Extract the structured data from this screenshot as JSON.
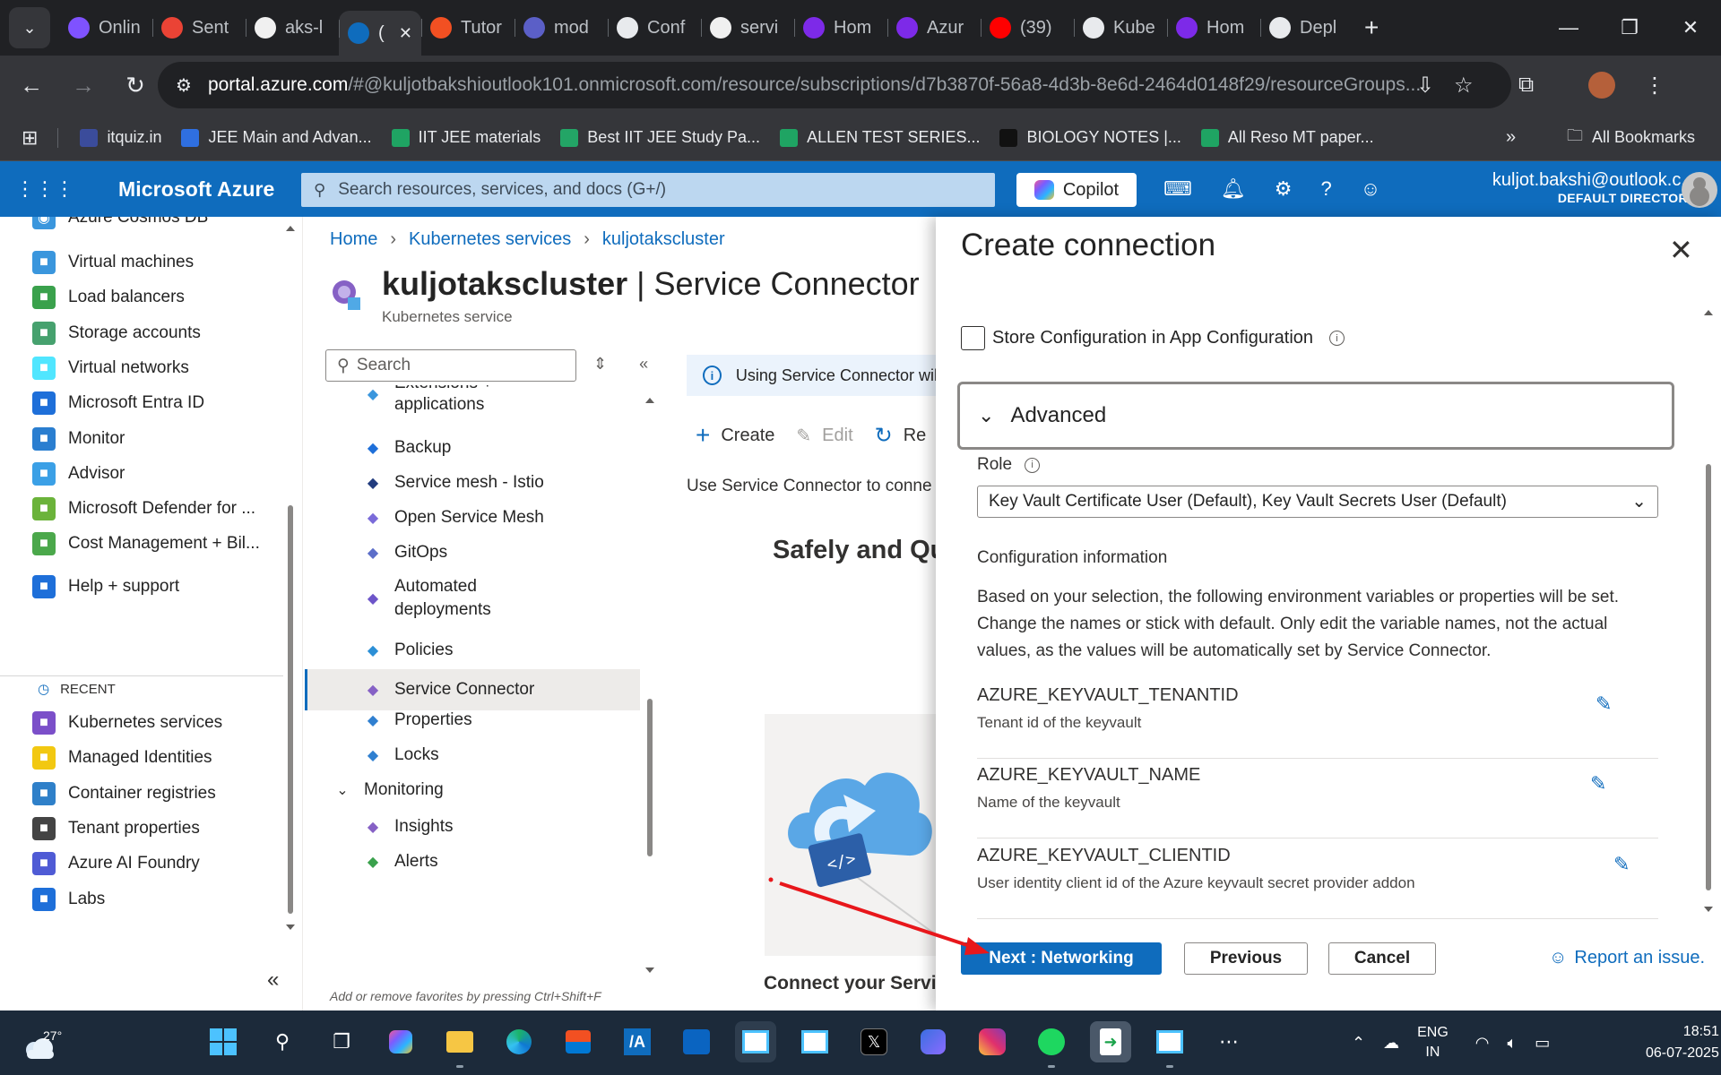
{
  "browser": {
    "tabs": [
      {
        "label": "Onlin",
        "icon": "onlinegdb-icon",
        "color": "#7f52ff"
      },
      {
        "label": "Sent",
        "icon": "gmail-icon",
        "color": "#ea4335"
      },
      {
        "label": "aks-l",
        "icon": "github-icon",
        "color": "#f0f0f0"
      },
      {
        "label": "(",
        "icon": "azure-icon",
        "color": "#0f6cbd",
        "active": true
      },
      {
        "label": "Tutor",
        "icon": "microsoft-icon",
        "color": "#f25022"
      },
      {
        "label": "mod",
        "icon": "docs-icon",
        "color": "#5b5fc7"
      },
      {
        "label": "Conf",
        "icon": "chatgpt-icon",
        "color": "#e8eaed"
      },
      {
        "label": "servi",
        "icon": "github-icon",
        "color": "#f0f0f0"
      },
      {
        "label": "Hom",
        "icon": "canva-icon",
        "color": "#7d2ae8"
      },
      {
        "label": "Azur",
        "icon": "canva-icon",
        "color": "#7d2ae8"
      },
      {
        "label": "(39) ",
        "icon": "youtube-icon",
        "color": "#ff0000"
      },
      {
        "label": "Kube",
        "icon": "chatgpt-icon",
        "color": "#e8eaed"
      },
      {
        "label": "Hom",
        "icon": "canva-icon",
        "color": "#7d2ae8"
      },
      {
        "label": "Depl",
        "icon": "chatgpt-icon",
        "color": "#e8eaed"
      }
    ],
    "url_host": "portal.azure.com",
    "url_rest": "/#@kuljotbakshioutlook101.onmicrosoft.com/resource/subscriptions/d7b3870f-56a8-4d3b-8e6d-2464d0148f29/resourceGroups...",
    "bookmarks": [
      {
        "label": "itquiz.in",
        "color": "#3b4c9b"
      },
      {
        "label": "JEE Main and Advan...",
        "color": "#2f6fe0"
      },
      {
        "label": "IIT JEE materials",
        "color": "#1fa463"
      },
      {
        "label": "Best IIT JEE Study Pa...",
        "color": "#23a566"
      },
      {
        "label": "ALLEN TEST SERIES...",
        "color": "#1fa463"
      },
      {
        "label": "BIOLOGY NOTES |...",
        "color": "#111111"
      },
      {
        "label": "All Reso MT paper...",
        "color": "#1fa463"
      }
    ],
    "all_bookmarks": "All Bookmarks"
  },
  "azure": {
    "brand": "Microsoft Azure",
    "search_placeholder": "Search resources, services, and docs (G+/)",
    "copilot": "Copilot",
    "account_email": "kuljot.bakshi@outlook.c...",
    "account_dir": "DEFAULT DIRECTORY"
  },
  "leftnav": {
    "partial": "Azure Cosmos DB",
    "items": [
      {
        "label": "Virtual machines",
        "icon": "virtual-machine-icon",
        "color": "#3a96dd"
      },
      {
        "label": "Load balancers",
        "icon": "load-balancer-icon",
        "color": "#3aa14c"
      },
      {
        "label": "Storage accounts",
        "icon": "storage-icon",
        "color": "#46a16e"
      },
      {
        "label": "Virtual networks",
        "icon": "vnet-icon",
        "color": "#50e6ff"
      },
      {
        "label": "Microsoft Entra ID",
        "icon": "entra-icon",
        "color": "#1e6fd9"
      },
      {
        "label": "Monitor",
        "icon": "monitor-icon",
        "color": "#2a7ed0"
      },
      {
        "label": "Advisor",
        "icon": "advisor-icon",
        "color": "#3ba0e6"
      },
      {
        "label": "Microsoft Defender for ...",
        "icon": "defender-icon",
        "color": "#6bb33a"
      },
      {
        "label": "Cost Management + Bil...",
        "icon": "cost-icon",
        "color": "#4ba84b"
      }
    ],
    "help": {
      "label": "Help + support",
      "icon": "help-support-icon",
      "color": "#1e6fd9"
    },
    "recent_label": "RECENT",
    "recent": [
      {
        "label": "Kubernetes services",
        "icon": "kubernetes-icon",
        "color": "#7b4fc9"
      },
      {
        "label": "Managed Identities",
        "icon": "identity-icon",
        "color": "#f2c811"
      },
      {
        "label": "Container registries",
        "icon": "container-registry-icon",
        "color": "#2f80c9"
      },
      {
        "label": "Tenant properties",
        "icon": "gear-icon",
        "color": "#444"
      },
      {
        "label": "Azure AI Foundry",
        "icon": "ai-foundry-icon",
        "color": "#4f5bd5"
      },
      {
        "label": "Labs",
        "icon": "labs-icon",
        "color": "#1e6fd9"
      }
    ]
  },
  "main": {
    "breadcrumb": [
      "Home",
      "Kubernetes services",
      "kuljotakscluster"
    ],
    "title_bold": "kuljotakscluster",
    "title_rest": " | Service Connector",
    "subtitle": "Kubernetes service",
    "search_placeholder": "Search",
    "menu": [
      {
        "label": "Extensions + applications",
        "icon": "extensions-icon"
      },
      {
        "label": "Backup",
        "icon": "backup-icon"
      },
      {
        "label": "Service mesh - Istio",
        "icon": "istio-icon"
      },
      {
        "label": "Open Service Mesh",
        "icon": "mesh-icon"
      },
      {
        "label": "GitOps",
        "icon": "gitops-icon"
      },
      {
        "label": "Automated deployments",
        "icon": "deploy-icon"
      },
      {
        "label": "Policies",
        "icon": "policy-icon"
      },
      {
        "label": "Service Connector",
        "icon": "service-connector-icon",
        "selected": true
      },
      {
        "label": "Properties",
        "icon": "properties-icon"
      },
      {
        "label": "Locks",
        "icon": "lock-icon"
      },
      {
        "label": "Monitoring",
        "icon": "chevron-down-icon",
        "group": true
      },
      {
        "label": "Insights",
        "icon": "insights-icon"
      },
      {
        "label": "Alerts",
        "icon": "alert-icon"
      }
    ],
    "hint": "Add or remove favorites by pressing Ctrl+Shift+F",
    "info": "Using Service Connector wil",
    "commands": {
      "create": "Create",
      "edit": "Edit",
      "refresh": "Re"
    },
    "use_text": "Use Service Connector to conne",
    "safely": "Safely and Qu",
    "connect_your": "Connect your Servic"
  },
  "blade": {
    "title": "Create connection",
    "store_label": "Store Configuration in App Configuration",
    "store_checked": false,
    "advanced": "Advanced",
    "role_label": "Role",
    "role_value": "Key Vault Certificate User (Default), Key Vault Secrets User (Default)",
    "config_heading": "Configuration information",
    "config_desc": "Based on your selection, the following environment variables or properties will be set. Change the names or stick with default. Only edit the variable names, not the actual values, as the values will be automatically set by Service Connector.",
    "env": [
      {
        "name": "AZURE_KEYVAULT_TENANTID",
        "desc": "Tenant id of the keyvault"
      },
      {
        "name": "AZURE_KEYVAULT_NAME",
        "desc": "Name of the keyvault"
      },
      {
        "name": "AZURE_KEYVAULT_CLIENTID",
        "desc": "User identity client id of the Azure keyvault secret provider addon"
      }
    ],
    "next": "Next : Networking",
    "previous": "Previous",
    "cancel": "Cancel",
    "report": "Report an issue."
  },
  "taskbar": {
    "temp": "27°",
    "lang1": "ENG",
    "lang2": "IN",
    "time": "18:51",
    "date": "06-07-2025"
  },
  "annotation_color": "#e8171b"
}
